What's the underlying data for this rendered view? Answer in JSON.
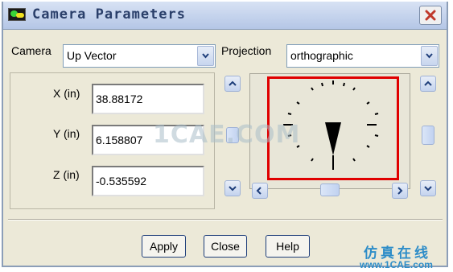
{
  "window": {
    "title": "Camera Parameters"
  },
  "camera": {
    "label": "Camera",
    "selected": "Up Vector"
  },
  "projection": {
    "label": "Projection",
    "selected": "orthographic"
  },
  "fields": [
    {
      "label": "X (in)",
      "value": "38.88172"
    },
    {
      "label": "Y (in)",
      "value": "6.158807"
    },
    {
      "label": "Z (in)",
      "value": "-0.535592"
    }
  ],
  "buttons": {
    "apply": "Apply",
    "close": "Close",
    "help": "Help"
  },
  "watermark": {
    "main": "1CAE.COM",
    "brand": "仿真在线",
    "url": "www.1CAE.com"
  },
  "colors": {
    "highlight": "#e00000",
    "watermark_blue": "#2e8dc8"
  }
}
